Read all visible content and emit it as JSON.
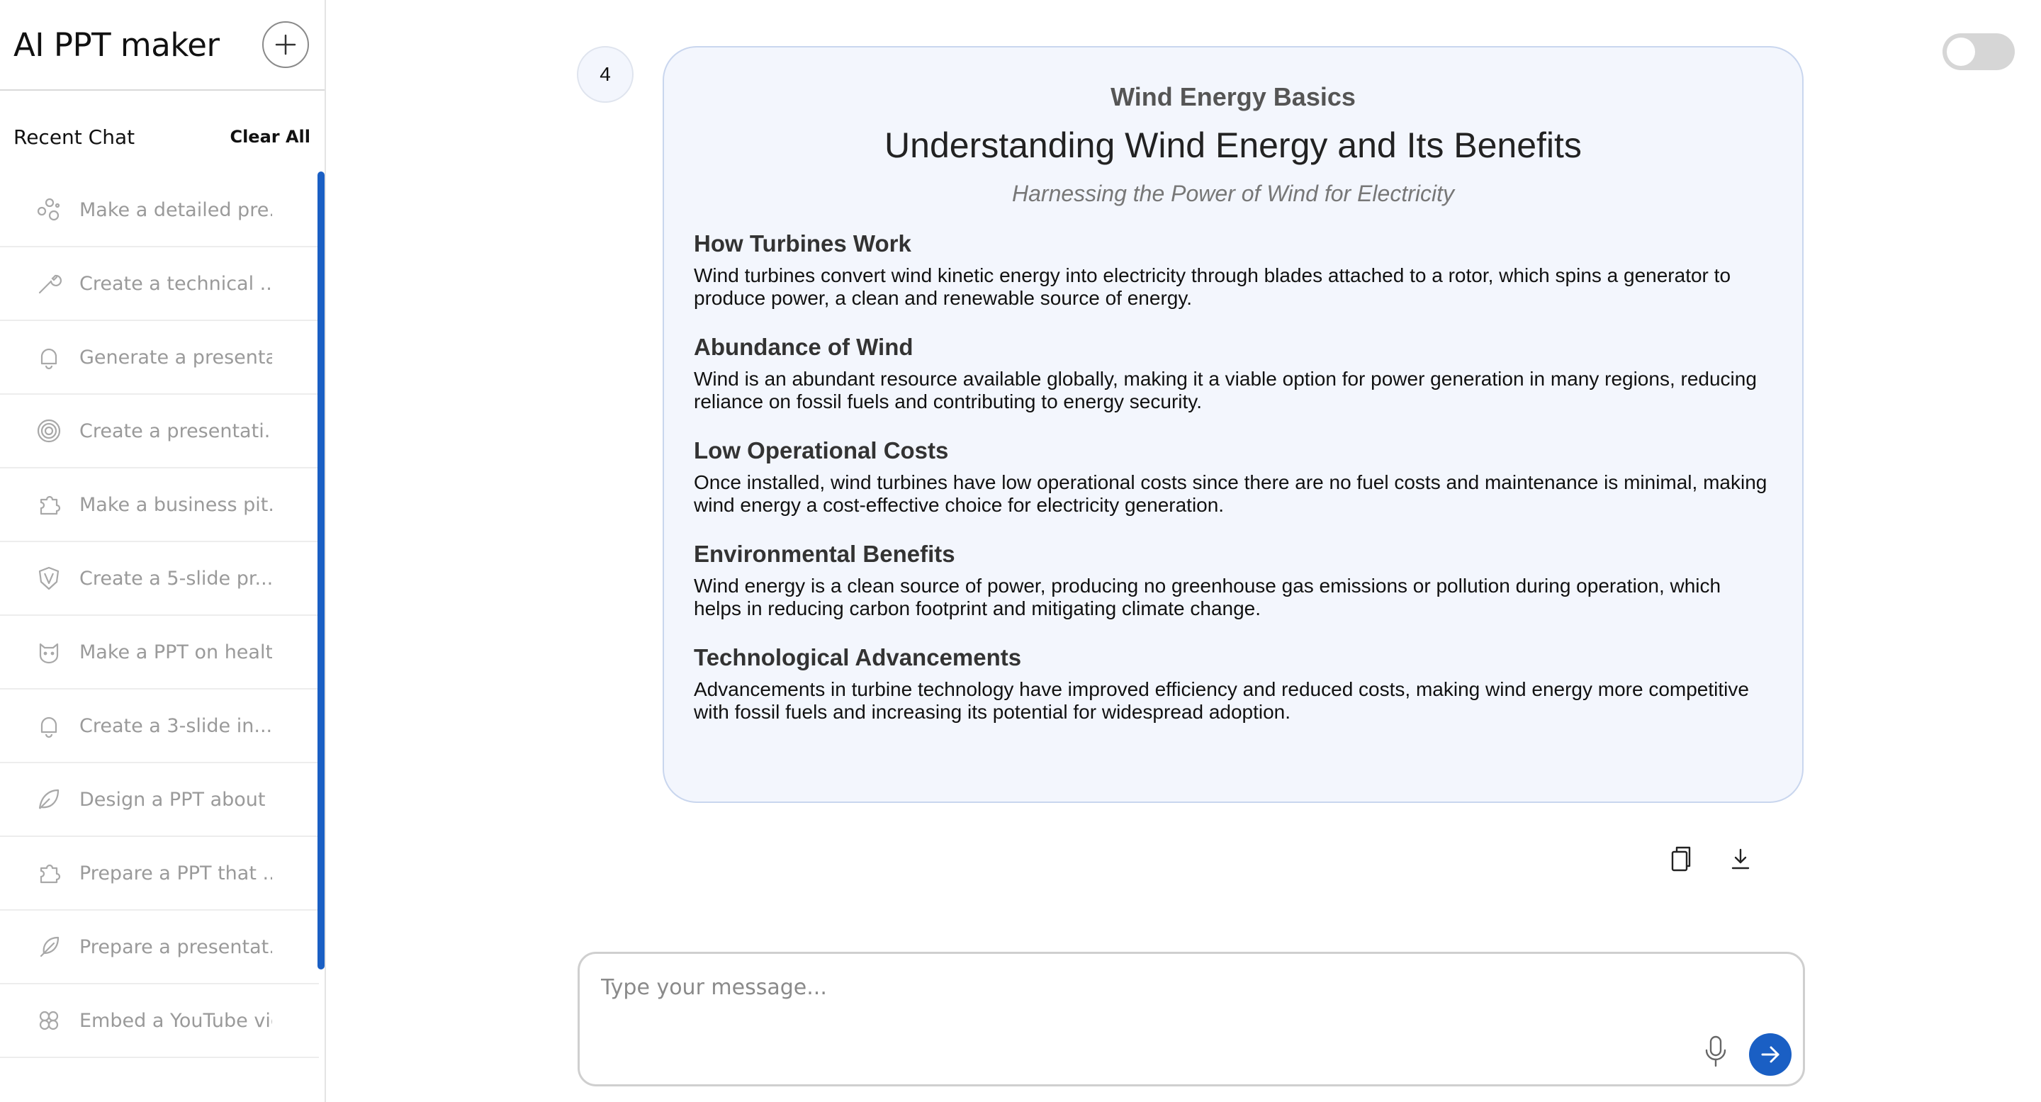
{
  "app": {
    "title": "AI PPT maker"
  },
  "sidebar": {
    "recent_label": "Recent Chat",
    "clear_all_label": "Clear All",
    "chats": [
      {
        "icon": "sparkle-dots-icon",
        "text": "Make a detailed pre..."
      },
      {
        "icon": "wrench-icon",
        "text": "Create a technical ..."
      },
      {
        "icon": "bell-icon",
        "text": "Generate a presenta.."
      },
      {
        "icon": "spiral-icon",
        "text": "Create a presentati..."
      },
      {
        "icon": "puzzle-icon",
        "text": "Make a business pit..."
      },
      {
        "icon": "shield-icon",
        "text": "Create a 5-slide pr..."
      },
      {
        "icon": "cat-icon",
        "text": "Make a PPT on healt."
      },
      {
        "icon": "bell-icon",
        "text": "Create a 3-slide in..."
      },
      {
        "icon": "leaf-icon",
        "text": "Design a PPT about .."
      },
      {
        "icon": "puzzle-icon",
        "text": "Prepare a PPT that ..."
      },
      {
        "icon": "feather-icon",
        "text": "Prepare a presentat.."
      },
      {
        "icon": "flower-icon",
        "text": "Embed a YouTube vid"
      }
    ]
  },
  "message": {
    "number": "4",
    "slide": {
      "label": "Wind Energy Basics",
      "title": "Understanding Wind Energy and Its Benefits",
      "subtitle": "Harnessing the Power of Wind for Electricity",
      "sections": [
        {
          "heading": "How Turbines Work",
          "body": "Wind turbines convert wind kinetic energy into electricity through blades attached to a rotor, which spins a generator to produce power, a clean and renewable source of energy."
        },
        {
          "heading": "Abundance of Wind",
          "body": "Wind is an abundant resource available globally, making it a viable option for power generation in many regions, reducing reliance on fossil fuels and contributing to energy security."
        },
        {
          "heading": "Low Operational Costs",
          "body": "Once installed, wind turbines have low operational costs since there are no fuel costs and maintenance is minimal, making wind energy a cost-effective choice for electricity generation."
        },
        {
          "heading": "Environmental Benefits",
          "body": "Wind energy is a clean source of power, producing no greenhouse gas emissions or pollution during operation, which helps in reducing carbon footprint and mitigating climate change."
        },
        {
          "heading": "Technological Advancements",
          "body": "Advancements in turbine technology have improved efficiency and reduced costs, making wind energy more competitive with fossil fuels and increasing its potential for widespread adoption."
        }
      ]
    },
    "actions": {
      "copy_icon": "copy-icon",
      "download_icon": "download-icon"
    }
  },
  "composer": {
    "placeholder": "Type your message...",
    "value": "",
    "mic_icon": "microphone-icon",
    "send_icon": "arrow-right-icon"
  },
  "theme": {
    "accent": "#1a5fc4",
    "card_bg": "#f3f6fd",
    "muted_text": "#9a9a9a"
  },
  "toggle": {
    "state": "off"
  }
}
